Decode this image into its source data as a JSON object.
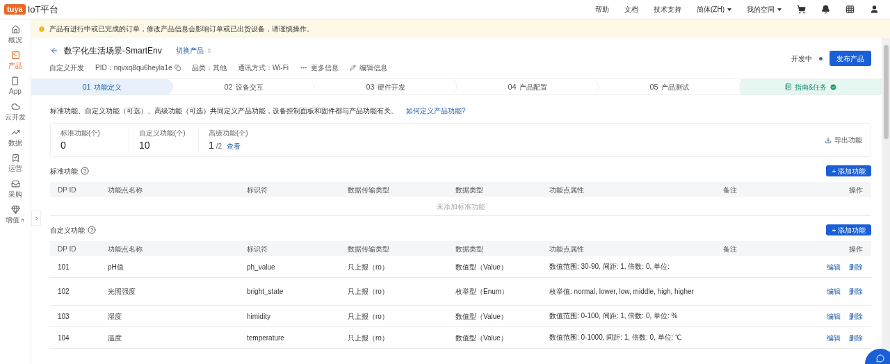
{
  "brand": {
    "logo": "tuya",
    "title": "IoT平台"
  },
  "top_nav": [
    {
      "label": "帮助",
      "dropdown": false
    },
    {
      "label": "文档",
      "dropdown": false
    },
    {
      "label": "技术支持",
      "dropdown": false
    },
    {
      "label": "简体(ZH)",
      "dropdown": true
    },
    {
      "label": "我的空间",
      "dropdown": true
    }
  ],
  "sidebar": {
    "items": [
      {
        "label": "概况",
        "selected": false,
        "external": false
      },
      {
        "label": "产品",
        "selected": true,
        "external": false
      },
      {
        "label": "App",
        "selected": false,
        "external": false
      },
      {
        "label": "云开发",
        "selected": false,
        "external": false
      },
      {
        "label": "数据",
        "selected": false,
        "external": false
      },
      {
        "label": "运营",
        "selected": false,
        "external": false
      },
      {
        "label": "采购",
        "selected": false,
        "external": false
      },
      {
        "label": "增值",
        "selected": false,
        "external": true
      }
    ]
  },
  "notice": "产品有进行中或已完成的订单，修改产品信息会影响订单或已出货设备，请谨慎操作。",
  "product": {
    "name": "数字化生活场景-SmartEnv",
    "switch": "切换产品",
    "meta": [
      {
        "kind": "text",
        "text": "自定义开发"
      },
      {
        "kind": "pid",
        "text": "PID：nqvxq8qu6heyla1e"
      },
      {
        "kind": "text",
        "text": "品类：其他"
      },
      {
        "kind": "text",
        "text": "通讯方式：Wi-Fi"
      },
      {
        "kind": "more",
        "text": "更多信息"
      },
      {
        "kind": "edit",
        "text": "编辑信息"
      }
    ],
    "status": "开发中",
    "publish": "发布产品"
  },
  "steps": [
    {
      "number": "01",
      "label": "功能定义",
      "selected": true
    },
    {
      "number": "02",
      "label": "设备交互",
      "selected": false
    },
    {
      "number": "03",
      "label": "硬件开发",
      "selected": false
    },
    {
      "number": "04",
      "label": "产品配置",
      "selected": false
    },
    {
      "number": "05",
      "label": "产品测试",
      "selected": false
    }
  ],
  "guide": {
    "label": "指南&任务",
    "done": true
  },
  "intro": "标准功能、自定义功能（可选）、高级功能（可选）共同定义产品功能，设备控制面板和固件都与产品功能有关。",
  "intro_link": "如何定义产品功能?",
  "stats": [
    {
      "label": "标准功能(个)",
      "value": "0"
    },
    {
      "label": "自定义功能(个)",
      "value": "10"
    },
    {
      "label": "高级功能(个)",
      "value": "1",
      "total": "/2",
      "link": "查看"
    }
  ],
  "export": "导出功能",
  "sections": [
    {
      "title": "标准功能",
      "add": "+ 添加功能",
      "columns": [
        "DP ID",
        "功能点名称",
        "标识符",
        "数据传输类型",
        "数据类型",
        "功能点属性",
        "备注",
        "操作"
      ],
      "empty": "未添加标准功能"
    },
    {
      "title": "自定义功能",
      "add": "+ 添加功能",
      "columns": [
        "DP ID",
        "功能点名称",
        "标识符",
        "数据传输类型",
        "数据类型",
        "功能点属性",
        "备注",
        "操作"
      ],
      "rows": [
        {
          "id": "101",
          "name": "pH值",
          "code": "ph_value",
          "transfer": "只上报（ro）",
          "type": "数值型（Value）",
          "props": "数值范围: 30-90, 间距: 1, 倍数: 0, 单位:",
          "actions": [
            "编辑",
            "删除"
          ]
        },
        {
          "id": "102",
          "name": "光照强度",
          "code": "bright_state",
          "transfer": "只上报（ro）",
          "type": "枚举型（Enum）",
          "props": "枚举值: normal, lower, low, middle, high, higher",
          "actions": [
            "编辑",
            "删除"
          ]
        },
        {
          "id": "103",
          "name": "湿度",
          "code": "himidity",
          "transfer": "只上报（ro）",
          "type": "数值型（Value）",
          "props": "数值范围: 0-100, 间距: 1, 倍数: 0, 单位: %",
          "actions": [
            "编辑",
            "删除"
          ]
        },
        {
          "id": "104",
          "name": "温度",
          "code": "temperature",
          "transfer": "只上报（ro）",
          "type": "数值型（Value）",
          "props": "数值范围: 0-1000, 间距: 1, 倍数: 0, 单位: ℃",
          "actions": [
            "编辑",
            "删除"
          ]
        }
      ]
    }
  ]
}
